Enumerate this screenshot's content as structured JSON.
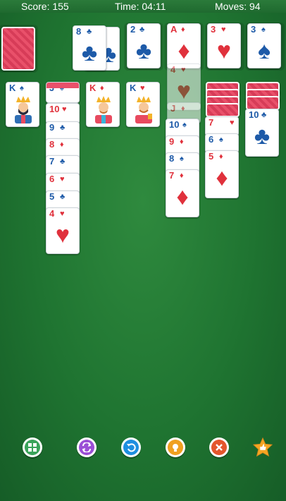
{
  "status": {
    "score": "Score: 155",
    "time": "Time: 04:11",
    "moves": "Moves: 94"
  },
  "waste": [
    {
      "rank": "8",
      "suit": "♣"
    }
  ],
  "foundations": [
    {
      "rank": "2",
      "suit": "♣"
    },
    {
      "rank": "A",
      "suit": "♦"
    },
    {
      "rank": "3",
      "suit": "♥"
    },
    {
      "rank": "3",
      "suit": "♠"
    }
  ],
  "tableau": {
    "col1": [
      {
        "rank": "K",
        "suit": "♠"
      }
    ],
    "col2": [
      {
        "rank": "J",
        "suit": "♠"
      },
      {
        "rank": "10",
        "suit": "♥"
      },
      {
        "rank": "9",
        "suit": "♣"
      },
      {
        "rank": "8",
        "suit": "♦"
      },
      {
        "rank": "7",
        "suit": "♣"
      },
      {
        "rank": "6",
        "suit": "♥"
      },
      {
        "rank": "5",
        "suit": "♣"
      },
      {
        "rank": "4",
        "suit": "♥"
      }
    ],
    "col3": [
      {
        "rank": "K",
        "suit": "♦"
      }
    ],
    "col4": [
      {
        "rank": "K",
        "suit": "♥"
      }
    ],
    "col5": [
      {
        "rank": "4",
        "suit": "♥"
      },
      {
        "rank": "J",
        "suit": "♦"
      },
      {
        "rank": "10",
        "suit": "♠"
      },
      {
        "rank": "9",
        "suit": "♦"
      },
      {
        "rank": "8",
        "suit": "♠"
      },
      {
        "rank": "7",
        "suit": "♦"
      }
    ],
    "col6": [
      {
        "rank": "7",
        "suit": "♥"
      },
      {
        "rank": "6",
        "suit": "♠"
      },
      {
        "rank": "5",
        "suit": "♦"
      }
    ],
    "col7": [
      {
        "rank": "10",
        "suit": "♣"
      }
    ]
  },
  "toolbar": [
    {
      "name": "games-button",
      "icon": "games-grid-icon",
      "color": "#3aa35a"
    },
    {
      "name": "shuffle-button",
      "icon": "shuffle-icon",
      "color": "#9b4fd6"
    },
    {
      "name": "undo-button",
      "icon": "undo-icon",
      "color": "#1e8fe0"
    },
    {
      "name": "hint-button",
      "icon": "lightbulb-icon",
      "color": "#f0a020"
    },
    {
      "name": "close-button",
      "icon": "close-icon",
      "color": "#e4562c"
    },
    {
      "name": "rate-button",
      "icon": "star-thumb-icon",
      "color": "#f5a623"
    }
  ]
}
